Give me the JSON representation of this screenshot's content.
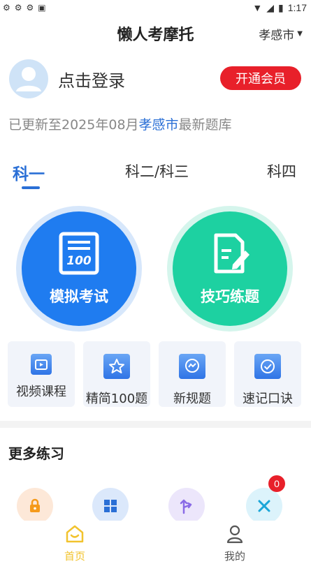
{
  "status_bar": {
    "time": "1:17"
  },
  "header": {
    "title": "懒人考摩托",
    "city": "孝感市"
  },
  "login": {
    "text": "点击登录",
    "vip_button": "开通会员"
  },
  "update": {
    "prefix": "已更新至2025年08月",
    "city": "孝感市",
    "suffix": "最新题库"
  },
  "tabs": [
    {
      "label": "科一",
      "active": true
    },
    {
      "label": "科二/科三",
      "active": false
    },
    {
      "label": "科四",
      "active": false
    }
  ],
  "main_buttons": [
    {
      "label": "模拟考试",
      "color": "#1f7cf0",
      "icon": "exam-paper-icon"
    },
    {
      "label": "技巧练题",
      "color": "#1dd1a1",
      "icon": "edit-document-icon"
    }
  ],
  "quick_actions": [
    {
      "label": "视频课程",
      "icon": "video-icon"
    },
    {
      "label": "精简100题",
      "icon": "star-icon"
    },
    {
      "label": "新规题",
      "icon": "message-icon"
    },
    {
      "label": "速记口诀",
      "icon": "check-circle-icon"
    }
  ],
  "more_practice": {
    "title": "更多练习",
    "items": [
      {
        "icon": "lock-icon",
        "color": "#fde8d8"
      },
      {
        "icon": "grid-icon",
        "color": "#dbe8fb"
      },
      {
        "icon": "branch-icon",
        "color": "#ece6fb"
      },
      {
        "icon": "close-icon",
        "color": "#dcf3fb",
        "badge": "0"
      }
    ]
  },
  "bottom_nav": [
    {
      "label": "首页",
      "icon": "home-icon",
      "active": true,
      "color": "#f2c32e"
    },
    {
      "label": "我的",
      "icon": "user-icon",
      "active": false,
      "color": "#555555"
    }
  ]
}
